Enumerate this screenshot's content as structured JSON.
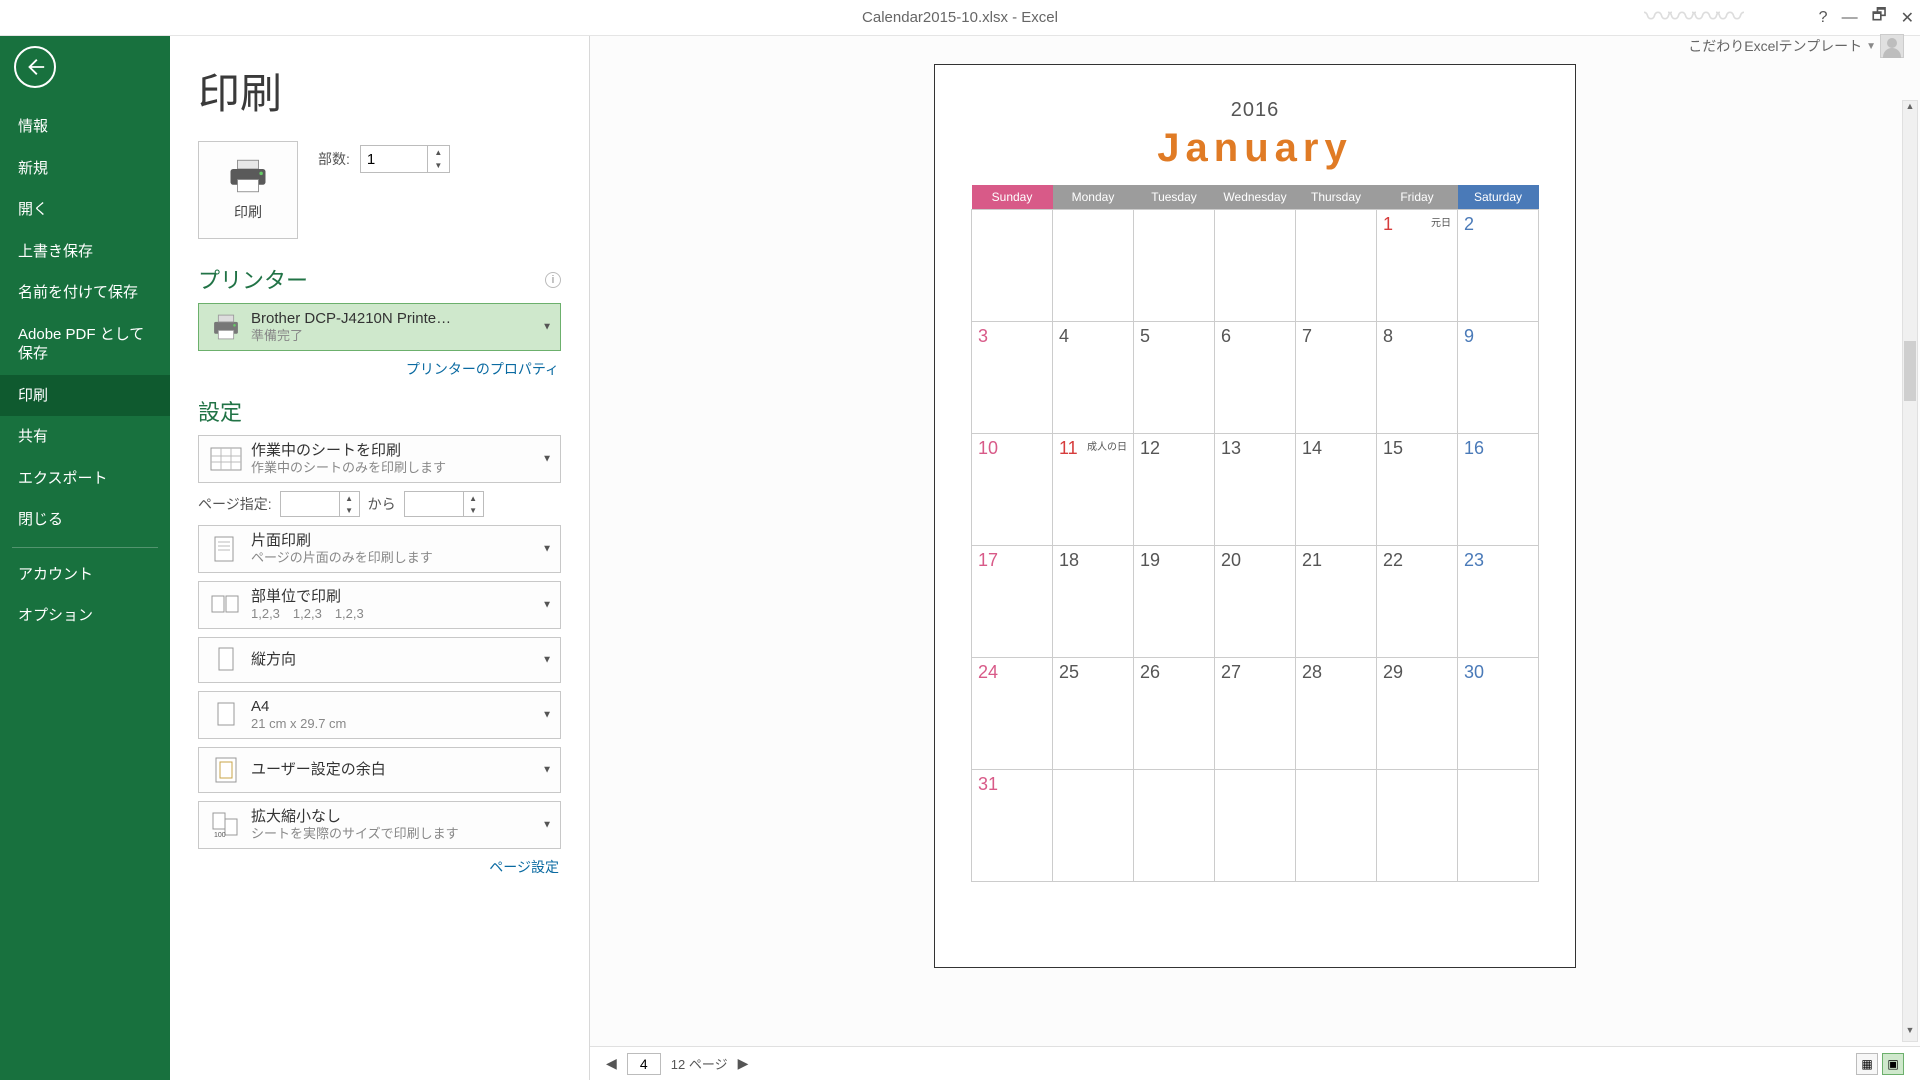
{
  "titlebar": {
    "title": "Calendar2015-10.xlsx - Excel"
  },
  "user": {
    "name": "こだわりExcelテンプレート"
  },
  "sidebar": {
    "items": [
      {
        "label": "情報"
      },
      {
        "label": "新規"
      },
      {
        "label": "開く"
      },
      {
        "label": "上書き保存"
      },
      {
        "label": "名前を付けて保存"
      },
      {
        "label": "Adobe PDF として保存"
      },
      {
        "label": "印刷"
      },
      {
        "label": "共有"
      },
      {
        "label": "エクスポート"
      },
      {
        "label": "閉じる"
      },
      {
        "label": "アカウント"
      },
      {
        "label": "オプション"
      }
    ]
  },
  "print": {
    "title": "印刷",
    "button_label": "印刷",
    "copies_label": "部数:",
    "copies_value": "1",
    "printer_section": "プリンター",
    "printer_name": "Brother DCP-J4210N Printe…",
    "printer_status": "準備完了",
    "printer_properties": "プリンターのプロパティ",
    "settings_section": "設定",
    "which": {
      "l1": "作業中のシートを印刷",
      "l2": "作業中のシートのみを印刷します"
    },
    "page_range_label": "ページ指定:",
    "page_from": "",
    "page_to_label": "から",
    "page_to": "",
    "sides": {
      "l1": "片面印刷",
      "l2": "ページの片面のみを印刷します"
    },
    "collate": {
      "l1": "部単位で印刷",
      "l2": "1,2,3　1,2,3　1,2,3"
    },
    "orient": {
      "l1": "縦方向"
    },
    "paper": {
      "l1": "A4",
      "l2": "21 cm x 29.7 cm"
    },
    "margins": {
      "l1": "ユーザー設定の余白"
    },
    "scale": {
      "l1": "拡大縮小なし",
      "l2": "シートを実際のサイズで印刷します"
    },
    "page_setup": "ページ設定"
  },
  "preview": {
    "page_current": "4",
    "page_total_label": "12 ページ"
  },
  "calendar": {
    "year": "2016",
    "month": "January",
    "days": [
      "Sunday",
      "Monday",
      "Tuesday",
      "Wednesday",
      "Thursday",
      "Friday",
      "Saturday"
    ],
    "weeks": [
      [
        {
          "n": "",
          "c": ""
        },
        {
          "n": "",
          "c": ""
        },
        {
          "n": "",
          "c": ""
        },
        {
          "n": "",
          "c": ""
        },
        {
          "n": "",
          "c": ""
        },
        {
          "n": "1",
          "c": "hol",
          "note": "元日"
        },
        {
          "n": "2",
          "c": "sat"
        }
      ],
      [
        {
          "n": "3",
          "c": "sun"
        },
        {
          "n": "4",
          "c": "nrm"
        },
        {
          "n": "5",
          "c": "nrm"
        },
        {
          "n": "6",
          "c": "nrm"
        },
        {
          "n": "7",
          "c": "nrm"
        },
        {
          "n": "8",
          "c": "nrm"
        },
        {
          "n": "9",
          "c": "sat"
        }
      ],
      [
        {
          "n": "10",
          "c": "sun"
        },
        {
          "n": "11",
          "c": "hol",
          "note": "成人の日"
        },
        {
          "n": "12",
          "c": "nrm"
        },
        {
          "n": "13",
          "c": "nrm"
        },
        {
          "n": "14",
          "c": "nrm"
        },
        {
          "n": "15",
          "c": "nrm"
        },
        {
          "n": "16",
          "c": "sat"
        }
      ],
      [
        {
          "n": "17",
          "c": "sun"
        },
        {
          "n": "18",
          "c": "nrm"
        },
        {
          "n": "19",
          "c": "nrm"
        },
        {
          "n": "20",
          "c": "nrm"
        },
        {
          "n": "21",
          "c": "nrm"
        },
        {
          "n": "22",
          "c": "nrm"
        },
        {
          "n": "23",
          "c": "sat"
        }
      ],
      [
        {
          "n": "24",
          "c": "sun"
        },
        {
          "n": "25",
          "c": "nrm"
        },
        {
          "n": "26",
          "c": "nrm"
        },
        {
          "n": "27",
          "c": "nrm"
        },
        {
          "n": "28",
          "c": "nrm"
        },
        {
          "n": "29",
          "c": "nrm"
        },
        {
          "n": "30",
          "c": "sat"
        }
      ],
      [
        {
          "n": "31",
          "c": "sun"
        },
        {
          "n": "",
          "c": ""
        },
        {
          "n": "",
          "c": ""
        },
        {
          "n": "",
          "c": ""
        },
        {
          "n": "",
          "c": ""
        },
        {
          "n": "",
          "c": ""
        },
        {
          "n": "",
          "c": ""
        }
      ]
    ]
  }
}
